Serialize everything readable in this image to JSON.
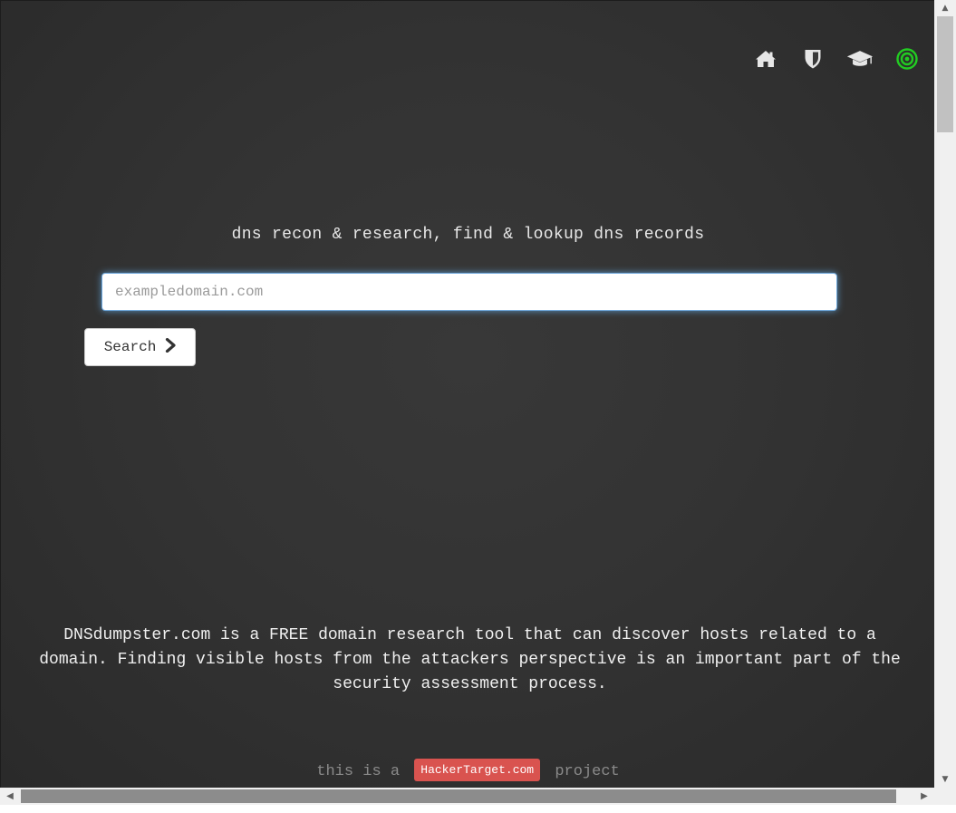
{
  "nav": {
    "icons": [
      "home-icon",
      "shield-icon",
      "graduation-cap-icon",
      "target-icon"
    ],
    "accent_color": "#22cc22"
  },
  "hero": {
    "tagline": "dns recon & research, find & lookup dns records"
  },
  "search": {
    "placeholder": "exampledomain.com",
    "value": "",
    "button_label": "Search"
  },
  "description": {
    "text": "DNSdumpster.com is a FREE domain research tool that can discover hosts related to a domain. Finding visible hosts from the attackers perspective is an important part of the security assessment process."
  },
  "footer": {
    "prefix": "this is a",
    "badge": "HackerTarget.com",
    "suffix": "project",
    "badge_color": "#d9534f"
  }
}
